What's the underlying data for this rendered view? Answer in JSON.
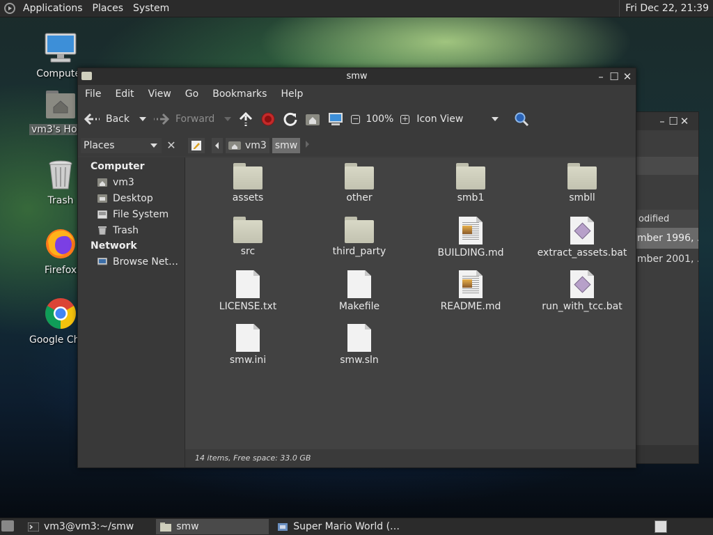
{
  "top_panel": {
    "menus": [
      "Applications",
      "Places",
      "System"
    ],
    "clock": "Fri Dec 22, 21:39"
  },
  "desktop_icons": [
    {
      "label": "Computer",
      "icon": "computer-icon"
    },
    {
      "label": "vm3's Home",
      "icon": "home-folder-icon"
    },
    {
      "label": "Trash",
      "icon": "trash-icon"
    },
    {
      "label": "Firefox",
      "icon": "firefox-icon"
    },
    {
      "label": "Google Chrome",
      "icon": "chrome-icon"
    }
  ],
  "background_window": {
    "column_header": "odified",
    "rows": [
      "mber 1996, ...",
      "mber 2001, ..."
    ]
  },
  "window": {
    "title": "smw",
    "menu": [
      "File",
      "Edit",
      "View",
      "Go",
      "Bookmarks",
      "Help"
    ],
    "toolbar": {
      "back": "Back",
      "forward": "Forward",
      "zoom": "100%",
      "view_mode": "Icon View"
    },
    "places_label": "Places",
    "breadcrumb": [
      "vm3",
      "smw"
    ],
    "sidebar": {
      "computer_heading": "Computer",
      "computer_items": [
        {
          "label": "vm3",
          "icon": "home-icon"
        },
        {
          "label": "Desktop",
          "icon": "desktop-icon"
        },
        {
          "label": "File System",
          "icon": "drive-icon"
        },
        {
          "label": "Trash",
          "icon": "trash-icon"
        }
      ],
      "network_heading": "Network",
      "network_items": [
        {
          "label": "Browse Net…",
          "icon": "network-icon"
        }
      ]
    },
    "files": [
      {
        "name": "assets",
        "type": "folder"
      },
      {
        "name": "other",
        "type": "folder"
      },
      {
        "name": "smb1",
        "type": "folder"
      },
      {
        "name": "smbll",
        "type": "folder"
      },
      {
        "name": "src",
        "type": "folder"
      },
      {
        "name": "third_party",
        "type": "folder"
      },
      {
        "name": "BUILDING.md",
        "type": "markdown"
      },
      {
        "name": "extract_assets.bat",
        "type": "script"
      },
      {
        "name": "LICENSE.txt",
        "type": "text"
      },
      {
        "name": "Makefile",
        "type": "text"
      },
      {
        "name": "README.md",
        "type": "markdown"
      },
      {
        "name": "run_with_tcc.bat",
        "type": "script"
      },
      {
        "name": "smw.ini",
        "type": "text"
      },
      {
        "name": "smw.sln",
        "type": "text"
      }
    ],
    "status": "14 items, Free space: 33.0 GB"
  },
  "taskbar": {
    "tasks": [
      {
        "label": "vm3@vm3:~/smw",
        "icon": "terminal-icon"
      },
      {
        "label": "smw",
        "icon": "folder-icon",
        "active": true
      },
      {
        "label": "Super Mario World (…",
        "icon": "game-icon"
      }
    ]
  }
}
